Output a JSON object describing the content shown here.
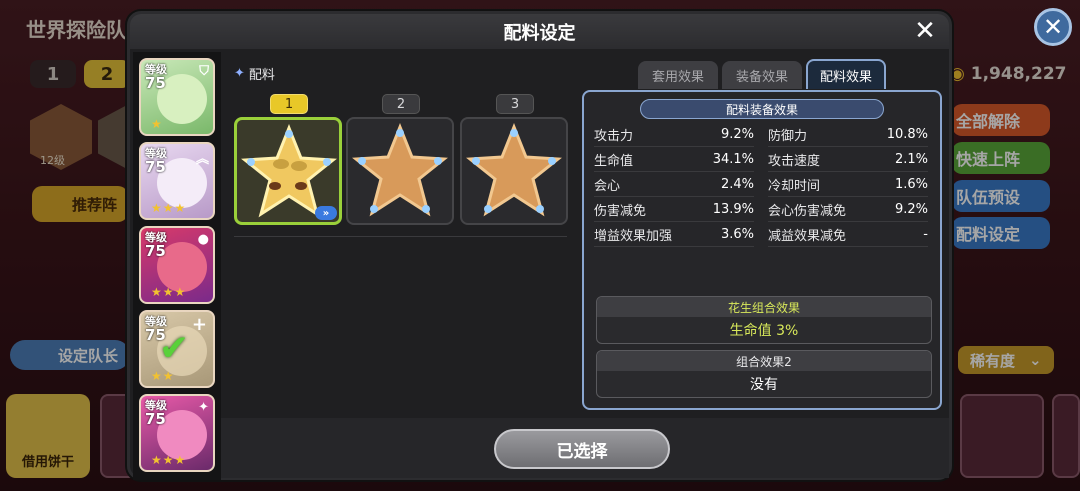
{
  "background": {
    "title": "世界探险队",
    "page_tabs": [
      "1",
      "2"
    ],
    "coins": "1,948,227",
    "recommend_btn": "推荐阵",
    "leader_btn": "设定队长",
    "borrow_btn": "借用饼干",
    "hex_level": "12级",
    "side_buttons": [
      "全部解除",
      "快速上阵",
      "队伍预设",
      "配料设定"
    ],
    "sort_label": "稀有度"
  },
  "modal": {
    "title": "配料设定",
    "close_icon": "close-icon"
  },
  "cookies": [
    {
      "level_label": "等级",
      "level": "75",
      "stars": "★",
      "selected": false
    },
    {
      "level_label": "等级",
      "level": "75",
      "stars": "★★★",
      "selected": false
    },
    {
      "level_label": "等级",
      "level": "75",
      "stars": "★★★",
      "selected": false
    },
    {
      "level_label": "等级",
      "level": "75",
      "stars": "★★",
      "selected": true
    },
    {
      "level_label": "等级",
      "level": "75",
      "stars": "★★★",
      "selected": false
    }
  ],
  "topping": {
    "section_label": "配料",
    "slots": [
      {
        "number": "1",
        "filled": true
      },
      {
        "number": "2",
        "filled": false
      },
      {
        "number": "3",
        "filled": false
      }
    ]
  },
  "tabs": [
    {
      "label": "套用效果",
      "active": false
    },
    {
      "label": "装备效果",
      "active": false
    },
    {
      "label": "配料效果",
      "active": true
    }
  ],
  "stats": {
    "header": "配料装备效果",
    "left": [
      {
        "name": "攻击力",
        "value": "9.2%"
      },
      {
        "name": "生命值",
        "value": "34.1%"
      },
      {
        "name": "会心",
        "value": "2.4%"
      },
      {
        "name": "伤害减免",
        "value": "13.9%"
      },
      {
        "name": "增益效果加强",
        "value": "3.6%"
      }
    ],
    "right": [
      {
        "name": "防御力",
        "value": "10.8%"
      },
      {
        "name": "攻击速度",
        "value": "2.1%"
      },
      {
        "name": "冷却时间",
        "value": "1.6%"
      },
      {
        "name": "会心伤害减免",
        "value": "9.2%"
      },
      {
        "name": "减益效果减免",
        "value": "-"
      }
    ]
  },
  "combos": [
    {
      "title": "花生组合效果",
      "value": "生命值 3%",
      "title_color": "#d8e85a",
      "value_color": "#d8e85a"
    },
    {
      "title": "组合效果2",
      "value": "没有",
      "title_color": "#e8e8ea",
      "value_color": "#ffffff"
    }
  ],
  "select_button": "已选择",
  "colors": {
    "accent_green": "#9ad03a",
    "accent_yellow": "#e8c828",
    "panel_border": "#8aa6d0"
  }
}
